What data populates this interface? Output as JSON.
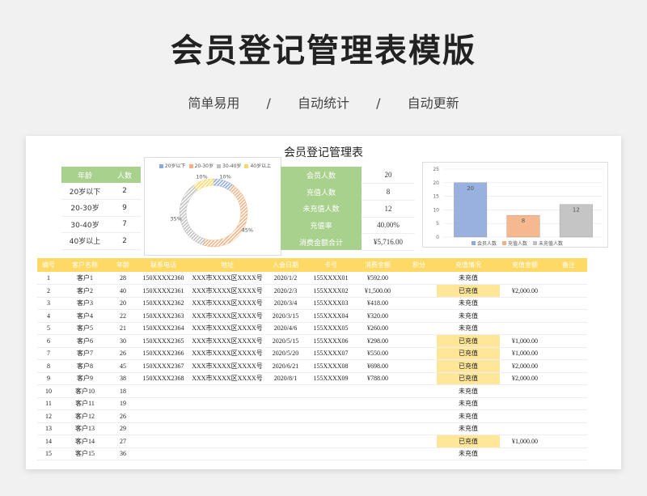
{
  "hero": {
    "title": "会员登记管理表模版",
    "tags": [
      "简单易用",
      "/",
      "自动统计",
      "/",
      "自动更新"
    ]
  },
  "sheet": {
    "title": "会员登记管理表"
  },
  "age_table": {
    "headers": [
      "年龄",
      "人数"
    ],
    "rows": [
      [
        "20岁以下",
        "2"
      ],
      [
        "20-30岁",
        "9"
      ],
      [
        "30-40岁",
        "7"
      ],
      [
        "40岁以上",
        "2"
      ]
    ]
  },
  "summary": {
    "rows": [
      [
        "会员人数",
        "20"
      ],
      [
        "充值人数",
        "8"
      ],
      [
        "未充值人数",
        "12"
      ],
      [
        "充值率",
        "40.00%"
      ],
      [
        "消费金额合计",
        "¥5,716.00"
      ]
    ]
  },
  "chart_data": [
    {
      "type": "pie",
      "donut": true,
      "categories": [
        "20岁以下",
        "20-30岁",
        "30-40岁",
        "40岁以上"
      ],
      "values": [
        10,
        45,
        35,
        10
      ],
      "labels": [
        "10%",
        "45%",
        "35%",
        "10%"
      ],
      "colors": [
        "#8ea9db",
        "#f4b183",
        "#bfbfbf",
        "#ffd966"
      ],
      "legend": "top"
    },
    {
      "type": "bar",
      "categories": [
        "会员人数",
        "充值人数",
        "未充值人数"
      ],
      "values": [
        20,
        8,
        12
      ],
      "colors": [
        "#8ea9db",
        "#f4b183",
        "#bfbfbf"
      ],
      "yticks": [
        "0",
        "5",
        "10",
        "15",
        "20",
        "25"
      ],
      "ylim": [
        0,
        25
      ],
      "legend": "bottom"
    }
  ],
  "main_table": {
    "headers": [
      "编号",
      "客户名称",
      "年龄",
      "联系电话",
      "地址",
      "入会日期",
      "卡号",
      "消费金额",
      "积分",
      "充值情况",
      "充值金额",
      "备注"
    ],
    "rows": [
      [
        "1",
        "客户1",
        "28",
        "150XXXX2360",
        "XXX市XXXX区XXXX号",
        "2020/1/2",
        "155XXXX01",
        "¥592.00",
        "",
        "未充值",
        "",
        ""
      ],
      [
        "2",
        "客户2",
        "40",
        "150XXXX2361",
        "XXX市XXXX区XXXX号",
        "2020/2/3",
        "155XXXX02",
        "¥1,500.00",
        "",
        "已充值",
        "¥2,000.00",
        ""
      ],
      [
        "3",
        "客户3",
        "20",
        "150XXXX2362",
        "XXX市XXXX区XXXX号",
        "2020/3/4",
        "155XXXX03",
        "¥418.00",
        "",
        "未充值",
        "",
        ""
      ],
      [
        "4",
        "客户4",
        "22",
        "150XXXX2363",
        "XXX市XXXX区XXXX号",
        "2020/3/15",
        "155XXXX04",
        "¥320.00",
        "",
        "未充值",
        "",
        ""
      ],
      [
        "5",
        "客户5",
        "21",
        "150XXXX2364",
        "XXX市XXXX区XXXX号",
        "2020/4/6",
        "155XXXX05",
        "¥260.00",
        "",
        "未充值",
        "",
        ""
      ],
      [
        "6",
        "客户6",
        "30",
        "150XXXX2365",
        "XXX市XXXX区XXXX号",
        "2020/5/15",
        "155XXXX06",
        "¥298.00",
        "",
        "已充值",
        "¥1,000.00",
        ""
      ],
      [
        "7",
        "客户7",
        "26",
        "150XXXX2366",
        "XXX市XXXX区XXXX号",
        "2020/5/20",
        "155XXXX07",
        "¥550.00",
        "",
        "已充值",
        "¥1,000.00",
        ""
      ],
      [
        "8",
        "客户8",
        "45",
        "150XXXX2367",
        "XXX市XXXX区XXXX号",
        "2020/6/21",
        "155XXXX08",
        "¥698.00",
        "",
        "已充值",
        "¥2,000.00",
        ""
      ],
      [
        "9",
        "客户9",
        "38",
        "150XXXX2368",
        "XXX市XXXX区XXXX号",
        "2020/8/1",
        "155XXXX09",
        "¥788.00",
        "",
        "已充值",
        "¥2,000.00",
        ""
      ],
      [
        "10",
        "客户10",
        "18",
        "",
        "",
        "",
        "",
        "",
        "",
        "未充值",
        "",
        ""
      ],
      [
        "11",
        "客户11",
        "19",
        "",
        "",
        "",
        "",
        "",
        "",
        "未充值",
        "",
        ""
      ],
      [
        "12",
        "客户12",
        "26",
        "",
        "",
        "",
        "",
        "",
        "",
        "未充值",
        "",
        ""
      ],
      [
        "13",
        "客户13",
        "29",
        "",
        "",
        "",
        "",
        "",
        "",
        "未充值",
        "",
        ""
      ],
      [
        "14",
        "客户14",
        "27",
        "",
        "",
        "",
        "",
        "",
        "",
        "已充值",
        "¥1,000.00",
        ""
      ],
      [
        "15",
        "客户15",
        "36",
        "",
        "",
        "",
        "",
        "",
        "",
        "未充值",
        "",
        ""
      ]
    ],
    "charged_value": "已充值"
  }
}
